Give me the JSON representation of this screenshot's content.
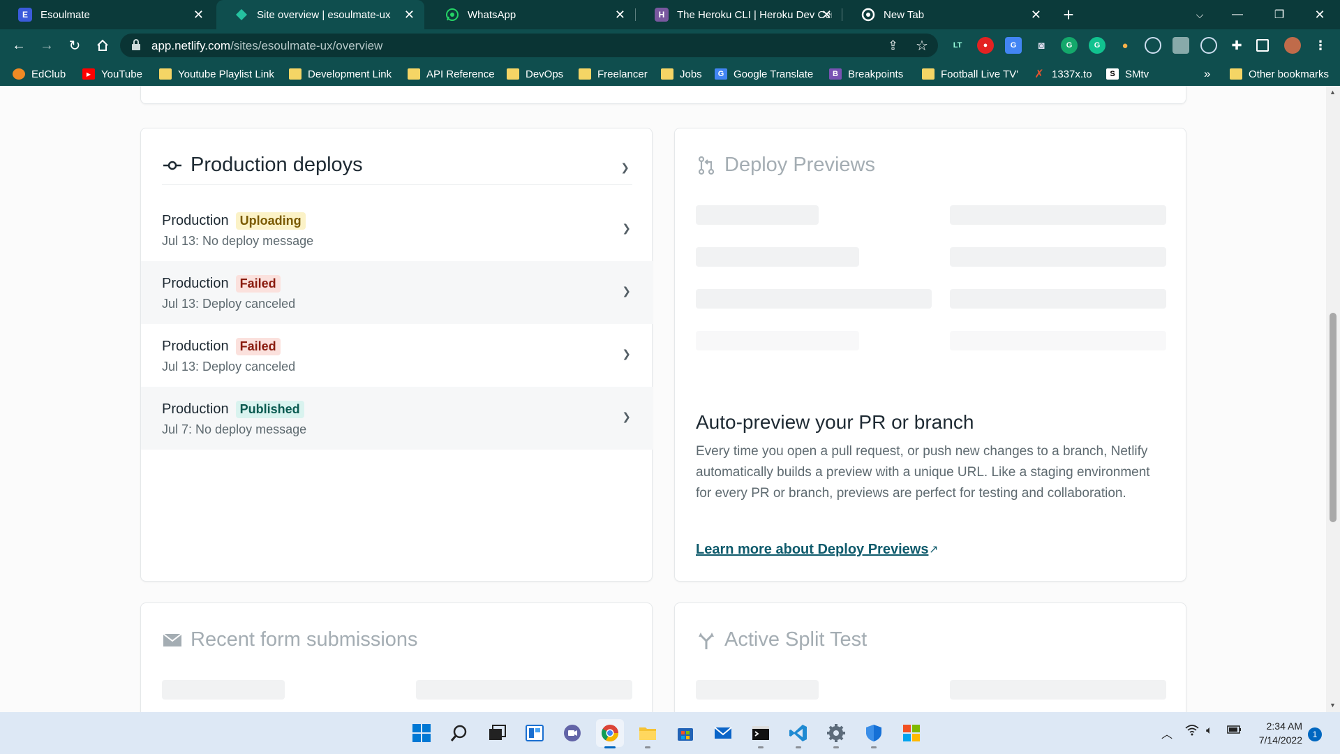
{
  "browser": {
    "tabs": [
      {
        "title": "Esoulmate",
        "favicon": "E",
        "favicon_color": "#3b5bdb",
        "active": false
      },
      {
        "title": "Site overview | esoulmate-ux",
        "favicon": "netlify-icon",
        "favicon_color": "#25c2a0",
        "active": true
      },
      {
        "title": "WhatsApp",
        "favicon": "whatsapp-icon",
        "favicon_color": "#25d366",
        "active": false
      },
      {
        "title": "The Heroku CLI | Heroku Dev Cen",
        "favicon": "H",
        "favicon_color": "#79589f",
        "active": false
      },
      {
        "title": "New Tab",
        "favicon": "chrome-icon",
        "favicon_color": "#ffffff",
        "active": false
      }
    ],
    "url_host": "app.netlify.com",
    "url_path": "/sites/esoulmate-ux/overview",
    "bookmarks": [
      {
        "label": "EdClub",
        "icon": "edclub-icon",
        "color": "#f08a24"
      },
      {
        "label": "YouTube",
        "icon": "youtube-icon",
        "color": "#ff0000"
      },
      {
        "label": "Youtube Playlist Link",
        "icon": "folder-icon",
        "color": "#f5d565"
      },
      {
        "label": "Development Link",
        "icon": "folder-icon",
        "color": "#f5d565"
      },
      {
        "label": "API Reference",
        "icon": "folder-icon",
        "color": "#f5d565"
      },
      {
        "label": "DevOps",
        "icon": "folder-icon",
        "color": "#f5d565"
      },
      {
        "label": "Freelancer",
        "icon": "folder-icon",
        "color": "#f5d565"
      },
      {
        "label": "Jobs",
        "icon": "folder-icon",
        "color": "#f5d565"
      },
      {
        "label": "Google Translate",
        "icon": "translate-icon",
        "color": "#4285f4"
      },
      {
        "label": "Breakpoints",
        "icon": "bootstrap-icon",
        "color": "#7952b3"
      },
      {
        "label": "Football Live TV'",
        "icon": "folder-icon",
        "color": "#f5d565"
      },
      {
        "label": "1337x.to",
        "icon": "x-icon",
        "color": "#e8542e"
      },
      {
        "label": "SMtv",
        "icon": "s-icon",
        "color": "#ffffff"
      }
    ],
    "bookmarks_overflow": "»",
    "other_bookmarks": "Other bookmarks"
  },
  "production_deploys": {
    "title": "Production deploys",
    "items": [
      {
        "label": "Production",
        "status": "Uploading",
        "status_bg": "#fbf2c7",
        "status_fg": "#7a5a00",
        "detail": "Jul 13: No deploy message"
      },
      {
        "label": "Production",
        "status": "Failed",
        "status_bg": "#fbe1dd",
        "status_fg": "#8a1c0f",
        "detail": "Jul 13: Deploy canceled"
      },
      {
        "label": "Production",
        "status": "Failed",
        "status_bg": "#fbe1dd",
        "status_fg": "#8a1c0f",
        "detail": "Jul 13: Deploy canceled"
      },
      {
        "label": "Production",
        "status": "Published",
        "status_bg": "#d9f3ef",
        "status_fg": "#0a5a50",
        "detail": "Jul 7: No deploy message"
      }
    ]
  },
  "deploy_previews": {
    "title": "Deploy Previews",
    "promo_heading": "Auto-preview your PR or branch",
    "promo_text": "Every time you open a pull request, or push new changes to a branch, Netlify automatically builds a preview with a unique URL. Like a staging environment for every PR or branch, previews are perfect for testing and collaboration.",
    "link": "Learn more about Deploy Previews",
    "link_arrow": "↗"
  },
  "form_submissions": {
    "title": "Recent form submissions"
  },
  "split_test": {
    "title": "Active Split Test"
  },
  "taskbar": {
    "apps": [
      "windows-start-icon",
      "search-icon",
      "task-view-icon",
      "widgets-icon",
      "teams-chat-icon",
      "chrome-icon",
      "file-explorer-icon",
      "store-icon",
      "mail-icon",
      "terminal-icon",
      "vscode-icon",
      "settings-icon",
      "defender-icon",
      "office-icon"
    ],
    "time": "2:34 AM",
    "date": "7/14/2022",
    "notifications": "1"
  }
}
